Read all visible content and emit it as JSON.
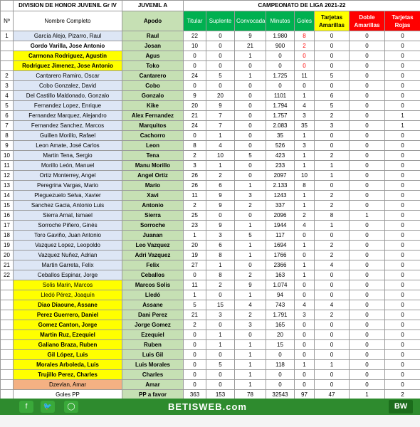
{
  "header": {
    "division": "DIVISION DE HONOR JUVENIL Gr IV",
    "team": "JUVENIL A",
    "campaign": "CAMPEONATO  DE LIGA 2021-22"
  },
  "columns": {
    "number": "Nº",
    "full_name": "Nombre Completo",
    "nickname": "Apodo",
    "starter": "Titular",
    "substitute": "Suplente",
    "called": "Convocada",
    "minutes": "Minutos",
    "goals": "Goles",
    "yellow_cards": "Tarjetas Amarillas",
    "double_yellow": "Doble Amarillas",
    "red_cards": "Tarjetas Rojas"
  },
  "players": [
    {
      "n": "1",
      "name": "García Alejo, Pizarro, Raul",
      "apodo": "Raul",
      "titular": "22",
      "suplente": "0",
      "convocada": "9",
      "minutos": "1.980",
      "goles": "8",
      "amarillas": "0",
      "doble": "0",
      "rojas": "0",
      "style": "blue",
      "goals_red": true
    },
    {
      "n": "",
      "name": "Gordo Varilla, Jose Antonio",
      "apodo": "Josan",
      "titular": "10",
      "suplente": "0",
      "convocada": "21",
      "minutos": "900",
      "goles": "2",
      "amarillas": "0",
      "doble": "0",
      "rojas": "0",
      "style": "white",
      "goals_red": true
    },
    {
      "n": "",
      "name": "Carmona Rodriguez, Agustin",
      "apodo": "Agus",
      "titular": "0",
      "suplente": "0",
      "convocada": "1",
      "minutos": "0",
      "goles": "0",
      "amarillas": "0",
      "doble": "0",
      "rojas": "0",
      "style": "yellow",
      "goals_red": true
    },
    {
      "n": "",
      "name": "Rodriguez Jimenez, Jose Antonio",
      "apodo": "Toko",
      "titular": "0",
      "suplente": "0",
      "convocada": "0",
      "minutos": "0",
      "goles": "0",
      "amarillas": "0",
      "doble": "0",
      "rojas": "0",
      "style": "yellow",
      "goals_red": true
    },
    {
      "n": "2",
      "name": "Cantarero Ramiro, Oscar",
      "apodo": "Cantarero",
      "titular": "24",
      "suplente": "5",
      "convocada": "1",
      "minutos": "1.725",
      "goles": "11",
      "amarillas": "5",
      "doble": "0",
      "rojas": "0",
      "style": "blue"
    },
    {
      "n": "3",
      "name": "Cobo Gonzalez, David",
      "apodo": "Cobo",
      "titular": "0",
      "suplente": "0",
      "convocada": "0",
      "minutos": "0",
      "goles": "0",
      "amarillas": "0",
      "doble": "0",
      "rojas": "0",
      "style": "blue"
    },
    {
      "n": "4",
      "name": "Del Castillo Maldonado, Gonzalo",
      "apodo": "Gonzalo",
      "titular": "9",
      "suplente": "20",
      "convocada": "0",
      "minutos": "1101",
      "goles": "1",
      "amarillas": "6",
      "doble": "0",
      "rojas": "0",
      "style": "blue"
    },
    {
      "n": "5",
      "name": "Fernandez Lopez, Enrique",
      "apodo": "Kike",
      "titular": "20",
      "suplente": "9",
      "convocada": "0",
      "minutos": "1.794",
      "goles": "4",
      "amarillas": "5",
      "doble": "0",
      "rojas": "0",
      "style": "blue"
    },
    {
      "n": "6",
      "name": "Fernandez Marquez, Alejandro",
      "apodo": "Alex Fernandez",
      "titular": "21",
      "suplente": "7",
      "convocada": "0",
      "minutos": "1.757",
      "goles": "3",
      "amarillas": "2",
      "doble": "0",
      "rojas": "1",
      "style": "blue"
    },
    {
      "n": "7",
      "name": "Fernandez Sanchez, Marcos",
      "apodo": "Marquitos",
      "titular": "24",
      "suplente": "7",
      "convocada": "0",
      "minutos": "2.083",
      "goles": "35",
      "amarillas": "3",
      "doble": "0",
      "rojas": "1",
      "style": "blue"
    },
    {
      "n": "8",
      "name": "Guillen Morillo, Rafael",
      "apodo": "Cachorro",
      "titular": "0",
      "suplente": "1",
      "convocada": "0",
      "minutos": "35",
      "goles": "1",
      "amarillas": "0",
      "doble": "0",
      "rojas": "0",
      "style": "blue"
    },
    {
      "n": "9",
      "name": "Leon Amate, José Carlos",
      "apodo": "Leon",
      "titular": "8",
      "suplente": "4",
      "convocada": "0",
      "minutos": "526",
      "goles": "3",
      "amarillas": "0",
      "doble": "0",
      "rojas": "0",
      "style": "blue"
    },
    {
      "n": "10",
      "name": "Martin Tena, Sergio",
      "apodo": "Tena",
      "titular": "2",
      "suplente": "10",
      "convocada": "5",
      "minutos": "423",
      "goles": "1",
      "amarillas": "2",
      "doble": "0",
      "rojas": "0",
      "style": "blue"
    },
    {
      "n": "11",
      "name": "Morillo León, Manuel",
      "apodo": "Manu Morillo",
      "titular": "3",
      "suplente": "1",
      "convocada": "0",
      "minutos": "233",
      "goles": "1",
      "amarillas": "1",
      "doble": "0",
      "rojas": "0",
      "style": "blue"
    },
    {
      "n": "12",
      "name": "Ortiz Monterrey, Angel",
      "apodo": "Angel Ortiz",
      "titular": "26",
      "suplente": "2",
      "convocada": "0",
      "minutos": "2097",
      "goles": "10",
      "amarillas": "1",
      "doble": "0",
      "rojas": "0",
      "style": "blue"
    },
    {
      "n": "13",
      "name": "Peregrina Vargas, Mario",
      "apodo": "Mario",
      "titular": "26",
      "suplente": "6",
      "convocada": "1",
      "minutos": "2.133",
      "goles": "8",
      "amarillas": "0",
      "doble": "0",
      "rojas": "0",
      "style": "blue"
    },
    {
      "n": "14",
      "name": "Pleguezuelo Selva, Xavier",
      "apodo": "Xavi",
      "titular": "11",
      "suplente": "9",
      "convocada": "3",
      "minutos": "1243",
      "goles": "1",
      "amarillas": "2",
      "doble": "0",
      "rojas": "0",
      "style": "blue"
    },
    {
      "n": "15",
      "name": "Sanchez Gacia, Antonio Luis",
      "apodo": "Antonio",
      "titular": "2",
      "suplente": "9",
      "convocada": "2",
      "minutos": "337",
      "goles": "1",
      "amarillas": "2",
      "doble": "0",
      "rojas": "0",
      "style": "blue"
    },
    {
      "n": "16",
      "name": "Sierra Arnal, Ismael",
      "apodo": "Sierra",
      "titular": "25",
      "suplente": "0",
      "convocada": "0",
      "minutos": "2096",
      "goles": "2",
      "amarillas": "8",
      "doble": "1",
      "rojas": "0",
      "style": "blue"
    },
    {
      "n": "17",
      "name": "Sorroche Piñero, Ginés",
      "apodo": "Sorroche",
      "titular": "23",
      "suplente": "9",
      "convocada": "1",
      "minutos": "1944",
      "goles": "4",
      "amarillas": "1",
      "doble": "0",
      "rojas": "0",
      "style": "blue"
    },
    {
      "n": "18",
      "name": "Toro Gaviño, Juan Antonio",
      "apodo": "Juanan",
      "titular": "1",
      "suplente": "3",
      "convocada": "5",
      "minutos": "117",
      "goles": "0",
      "amarillas": "0",
      "doble": "0",
      "rojas": "0",
      "style": "blue"
    },
    {
      "n": "19",
      "name": "Vazquez Lopez, Leopoldo",
      "apodo": "Leo Vazquez",
      "titular": "20",
      "suplente": "6",
      "convocada": "1",
      "minutos": "1694",
      "goles": "1",
      "amarillas": "2",
      "doble": "0",
      "rojas": "0",
      "style": "blue"
    },
    {
      "n": "20",
      "name": "Vazquez Nuñez, Adrian",
      "apodo": "Adri Vazquez",
      "titular": "19",
      "suplente": "8",
      "convocada": "1",
      "minutos": "1766",
      "goles": "0",
      "amarillas": "2",
      "doble": "0",
      "rojas": "0",
      "style": "blue"
    },
    {
      "n": "21",
      "name": "Martin Garreta, Felix",
      "apodo": "Felix",
      "titular": "27",
      "suplente": "1",
      "convocada": "0",
      "minutos": "2366",
      "goles": "1",
      "amarillas": "4",
      "doble": "0",
      "rojas": "0",
      "style": "blue"
    },
    {
      "n": "22",
      "name": "Ceballos Espinar, Jorge",
      "apodo": "Ceballos",
      "titular": "0",
      "suplente": "8",
      "convocada": "2",
      "minutos": "163",
      "goles": "1",
      "amarillas": "0",
      "doble": "0",
      "rojas": "0",
      "style": "blue"
    },
    {
      "n": "",
      "name": "Solis Marin, Marcos",
      "apodo": "Marcos Solis",
      "titular": "11",
      "suplente": "2",
      "convocada": "9",
      "minutos": "1.074",
      "goles": "0",
      "amarillas": "0",
      "doble": "0",
      "rojas": "0",
      "style": "yellow-plain"
    },
    {
      "n": "",
      "name": "Lledó Pérez, Joaquín",
      "apodo": "Lledó",
      "titular": "1",
      "suplente": "0",
      "convocada": "1",
      "minutos": "94",
      "goles": "0",
      "amarillas": "0",
      "doble": "0",
      "rojas": "0",
      "style": "yellow-plain"
    },
    {
      "n": "",
      "name": "Diao Diaoune, Assane",
      "apodo": "Assane",
      "titular": "5",
      "suplente": "15",
      "convocada": "4",
      "minutos": "743",
      "goles": "4",
      "amarillas": "4",
      "doble": "0",
      "rojas": "0",
      "style": "yellow"
    },
    {
      "n": "",
      "name": "Perez Guerrero, Daniel",
      "apodo": "Dani Perez",
      "titular": "21",
      "suplente": "3",
      "convocada": "2",
      "minutos": "1.791",
      "goles": "3",
      "amarillas": "2",
      "doble": "0",
      "rojas": "0",
      "style": "yellow"
    },
    {
      "n": "",
      "name": "Gomez Canton, Jorge",
      "apodo": "Jorge Gomez",
      "titular": "2",
      "suplente": "0",
      "convocada": "3",
      "minutos": "165",
      "goles": "0",
      "amarillas": "0",
      "doble": "0",
      "rojas": "0",
      "style": "yellow"
    },
    {
      "n": "",
      "name": "Martin Ruz, Ezequiel",
      "apodo": "Ezequiel",
      "titular": "0",
      "suplente": "1",
      "convocada": "0",
      "minutos": "20",
      "goles": "0",
      "amarillas": "0",
      "doble": "0",
      "rojas": "0",
      "style": "yellow"
    },
    {
      "n": "",
      "name": "Galiano Braza, Ruben",
      "apodo": "Ruben",
      "titular": "0",
      "suplente": "1",
      "convocada": "1",
      "minutos": "15",
      "goles": "0",
      "amarillas": "0",
      "doble": "0",
      "rojas": "0",
      "style": "yellow"
    },
    {
      "n": "",
      "name": "Gil López, Luis",
      "apodo": "Luis Gil",
      "titular": "0",
      "suplente": "0",
      "convocada": "1",
      "minutos": "0",
      "goles": "0",
      "amarillas": "0",
      "doble": "0",
      "rojas": "0",
      "style": "yellow"
    },
    {
      "n": "",
      "name": "Morales Arboleda, Luis",
      "apodo": "Luis Morales",
      "titular": "0",
      "suplente": "5",
      "convocada": "1",
      "minutos": "118",
      "goles": "1",
      "amarillas": "1",
      "doble": "0",
      "rojas": "0",
      "style": "yellow"
    },
    {
      "n": "",
      "name": "Trujillo Perez, Charles",
      "apodo": "Charles",
      "titular": "0",
      "suplente": "0",
      "convocada": "1",
      "minutos": "0",
      "goles": "0",
      "amarillas": "0",
      "doble": "0",
      "rojas": "0",
      "style": "yellow"
    },
    {
      "n": "",
      "name": "Dzevlan, Amar",
      "apodo": "Amar",
      "titular": "0",
      "suplente": "0",
      "convocada": "1",
      "minutos": "0",
      "goles": "0",
      "amarillas": "0",
      "doble": "0",
      "rojas": "0",
      "style": "orange"
    }
  ],
  "totals": {
    "label": "Goles PP",
    "apodo_label": "PP a favor",
    "titular": "363",
    "suplente": "153",
    "convocada": "78",
    "minutos": "32543",
    "goles": "97",
    "amarillas": "47",
    "doble": "1",
    "rojas": "2"
  },
  "footer": {
    "brand": "BETISWEB.com",
    "logo": "BW",
    "social_icons": [
      "facebook-icon",
      "twitter-icon",
      "instagram-icon"
    ],
    "colors": {
      "footer_green": "#2e8b2e",
      "header_green": "#00b050",
      "yellow": "#ffff00",
      "red": "#ff0000",
      "apodo_green": "#c6e0b4",
      "name_blue": "#dde6f5",
      "orange": "#f4b183"
    }
  }
}
